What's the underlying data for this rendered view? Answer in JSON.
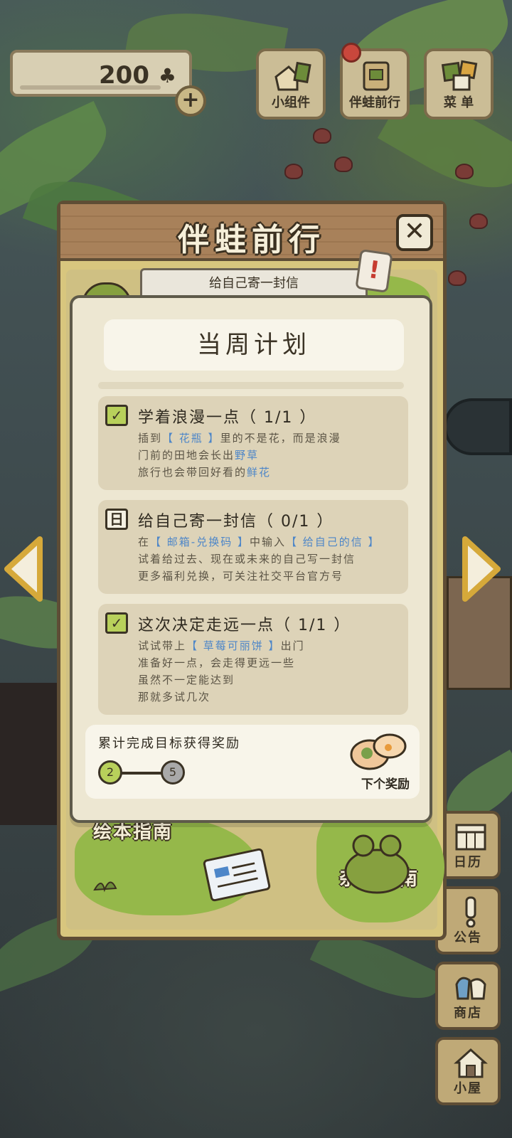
{
  "currency": {
    "amount": "200",
    "icon": "clover-icon"
  },
  "top_buttons": [
    {
      "label": "小组件",
      "icon": "widget-icon"
    },
    {
      "label": "伴蛙前行",
      "icon": "frog-journey-icon"
    },
    {
      "label": "菜 单",
      "icon": "menu-icon"
    }
  ],
  "modal": {
    "title": "伴蛙前行",
    "banner": "给自己寄一封信",
    "panel_title": "当周计划",
    "tasks": [
      {
        "title": "学着浪漫一点（ 1/1 ）",
        "status": "done",
        "lines": [
          [
            "插到",
            "【 花瓶 】",
            "里的不是花，而是浪漫"
          ],
          [
            "门前的田地会长出",
            "野草",
            ""
          ],
          [
            "旅行也会带回好看的",
            "鲜花",
            ""
          ]
        ]
      },
      {
        "title": "给自己寄一封信（ 0/1 ）",
        "status": "pending",
        "lines": [
          [
            "在",
            "【 邮箱-兑换码 】",
            "中输入"
          ],
          [
            "试着给过去、现在或未来的自己写一封信",
            "",
            ""
          ],
          [
            "更多福利兑换，可关注社交平台官方号",
            "",
            ""
          ]
        ],
        "line0_tail": "【 给自己的信 】"
      },
      {
        "title": "这次决定走远一点（ 1/1 ）",
        "status": "done",
        "lines": [
          [
            "试试带上",
            "【 草莓可丽饼 】",
            "出门"
          ],
          [
            "准备好一点，会走得更远一些",
            "",
            ""
          ],
          [
            "虽然不一定能达到",
            "",
            ""
          ],
          [
            "那就多试几次",
            "",
            ""
          ]
        ]
      }
    ],
    "reward": {
      "label": "累计完成目标获得奖励",
      "progress_current": "2",
      "progress_target": "5",
      "next_label": "下个奖励"
    },
    "guides": {
      "picture_book": "绘本指南",
      "misc": "杂项指南"
    }
  },
  "side_menu": [
    {
      "label": "日历",
      "icon": "calendar-icon"
    },
    {
      "label": "公告",
      "icon": "announcement-icon"
    },
    {
      "label": "商店",
      "icon": "shop-icon"
    },
    {
      "label": "小屋",
      "icon": "house-icon"
    }
  ],
  "colors": {
    "accent_green": "#b8d05b",
    "highlight_blue": "#4d86c8",
    "wood": "#a8815a",
    "alert_red": "#c63c30"
  }
}
